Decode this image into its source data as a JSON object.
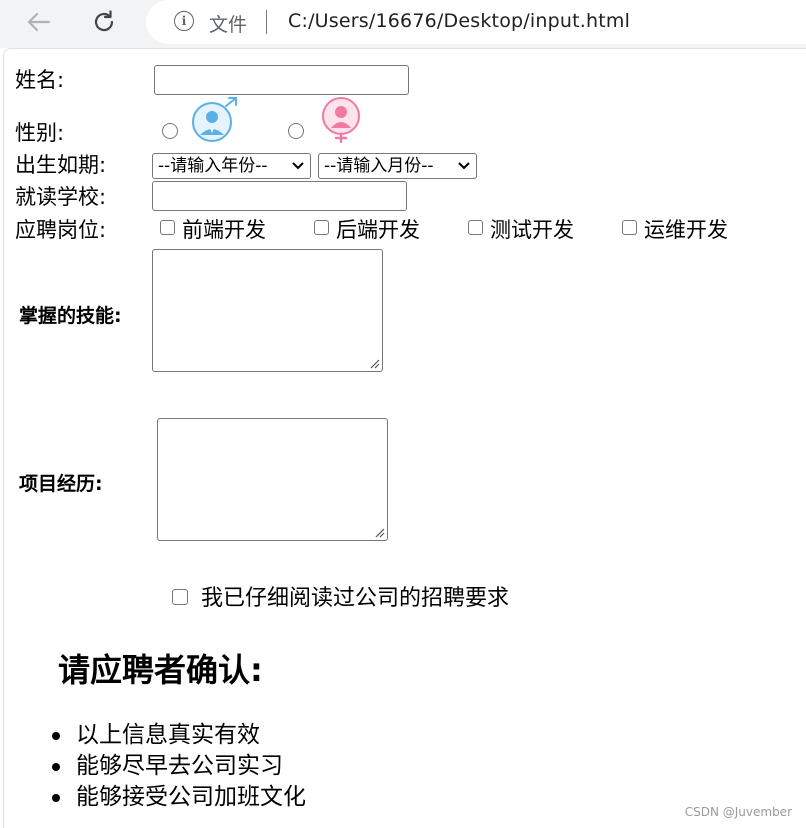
{
  "browser": {
    "file_label": "文件",
    "url": "C:/Users/16676/Desktop/input.html"
  },
  "form": {
    "name_label": "姓名:",
    "name_value": "",
    "gender_label": "性别:",
    "gender_options": [
      "male",
      "female"
    ],
    "birth_label": "出生如期:",
    "year_select": "--请输入年份--",
    "month_select": "--请输入月份--",
    "school_label": "就读学校:",
    "school_value": "",
    "position_label": "应聘岗位:",
    "positions": [
      "前端开发",
      "后端开发",
      "测试开发",
      "运维开发"
    ],
    "skills_label": "掌握的技能:",
    "project_label": "项目经历:",
    "agree_text": "我已仔细阅读过公司的招聘要求"
  },
  "confirm": {
    "heading": "请应聘者确认:",
    "items": [
      "以上信息真实有效",
      "能够尽早去公司实习",
      "能够接受公司加班文化"
    ]
  },
  "watermark": "CSDN @Juvember",
  "colors": {
    "male_icon": "#5bb0e6",
    "female_icon": "#f07aa3",
    "chrome_bg": "#f1f3f4"
  }
}
